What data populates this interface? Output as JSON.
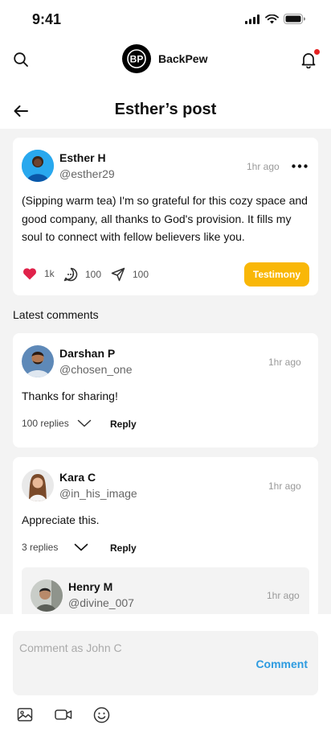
{
  "status_bar": {
    "time": "9:41"
  },
  "header": {
    "brand_name": "BackPew",
    "logo_text": "BP",
    "has_notification": true
  },
  "page": {
    "title": "Esther’s post"
  },
  "post": {
    "author_name": "Esther H",
    "author_handle": "@esther29",
    "time": "1hr ago",
    "text": "(Sipping warm tea) I'm so grateful for this cozy space and good company, all thanks to God's provision. It fills my soul to connect with fellow believers like you.",
    "likes": "1k",
    "comments": "100",
    "shares": "100",
    "tag": "Testimony"
  },
  "comments_section": {
    "label": "Latest comments"
  },
  "comments": [
    {
      "author_name": "Darshan P",
      "author_handle": "@chosen_one",
      "time": "1hr ago",
      "text": "Thanks for sharing!",
      "replies_label": "100 replies",
      "reply_label": "Reply"
    },
    {
      "author_name": "Kara C",
      "author_handle": "@in_his_image",
      "time": "1hr ago",
      "text": "Appreciate this.",
      "replies_label": "3 replies",
      "reply_label": "Reply",
      "nested_reply": {
        "author_name": "Henry M",
        "author_handle": "@divine_007",
        "time": "1hr ago"
      }
    }
  ],
  "composer": {
    "placeholder": "Comment as John C",
    "submit_label": "Comment"
  },
  "colors": {
    "accent": "#2d9be0",
    "badge": "#f9b707",
    "like": "#e0224a",
    "notification": "#e52222"
  }
}
